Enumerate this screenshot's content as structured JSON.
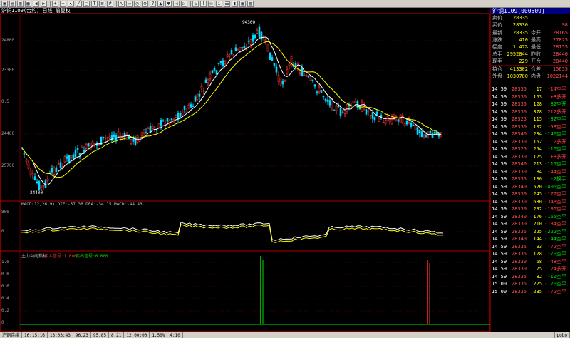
{
  "window": {
    "chart_title": "沪铜1109(合约) 日线 前复权",
    "instrument_title": "沪铜1109(000509)"
  },
  "toolbar": {
    "buttons": [
      "file",
      "open",
      "save",
      "print",
      "undo",
      "redo",
      "zoom-in",
      "zoom-out",
      "cursor",
      "line",
      "rect",
      "text",
      "fib",
      "grid",
      "indicator",
      "window",
      "period",
      "settings",
      "help",
      "up",
      "down",
      "left",
      "right",
      "refresh",
      "alert",
      "news",
      "info",
      "list",
      "chart",
      "table",
      "layout"
    ]
  },
  "price_axis": {
    "labels": [
      "24800",
      "23300",
      "0.5",
      "24400",
      "25700"
    ]
  },
  "panels": {
    "price": {
      "high_label": "94300",
      "low_label": "24400"
    },
    "macd": {
      "label": "MACD(12,26,9) DIF:-57.36 DEA:-34.15 MACD:-44.43",
      "axis": [
        "800",
        "0"
      ]
    },
    "signal": {
      "label1": "主力动向指标",
      "label2": "买入信号:1.000",
      "label3": "卖出信号:0.000",
      "axis": [
        "1.0",
        "0.8",
        "0.6",
        "0.4",
        "0.2",
        "0"
      ]
    }
  },
  "quote": {
    "rows": [
      {
        "l1": "卖价",
        "v1": "28335",
        "l2": "",
        "v2": ""
      },
      {
        "l1": "买价",
        "v1": "28330",
        "l2": "",
        "v2": "98"
      },
      {
        "l1": "最新",
        "v1": "28335",
        "l2": "今开",
        "v2": "28165"
      },
      {
        "l1": "涨跌",
        "v1": "410",
        "l2": "最高",
        "v2": "27825"
      },
      {
        "l1": "幅度",
        "v1": "1.47%",
        "l2": "最低",
        "v2": "28155"
      },
      {
        "l1": "总手",
        "v1": "2952844",
        "l2": "昨收",
        "v2": "28440"
      },
      {
        "l1": "现手",
        "v1": "229",
        "l2": "开仓",
        "v2": "28440"
      },
      {
        "l1": "持仓",
        "v1": "413302",
        "l2": "仓差",
        "v2": "15655"
      },
      {
        "l1": "外盘",
        "v1": "1030700",
        "l2": "内盘",
        "v2": "1022144"
      }
    ],
    "trades": [
      {
        "time": "14:59",
        "price": "28335",
        "vol": "17",
        "chg": "-14",
        "dir": "空平",
        "c": "red"
      },
      {
        "time": "14:59",
        "price": "28330",
        "vol": "163",
        "chg": "+8",
        "dir": "多开",
        "c": "red"
      },
      {
        "time": "14:59",
        "price": "28335",
        "vol": "128",
        "chg": "82",
        "dir": "空开",
        "c": "green"
      },
      {
        "time": "14:59",
        "price": "28330",
        "vol": "378",
        "chg": "212",
        "dir": "多开",
        "c": "red"
      },
      {
        "time": "14:59",
        "price": "28325",
        "vol": "115",
        "chg": "-82",
        "dir": "空平",
        "c": "green"
      },
      {
        "time": "14:59",
        "price": "28330",
        "vol": "102",
        "chg": "-58",
        "dir": "空平",
        "c": "red"
      },
      {
        "time": "14:59",
        "price": "28340",
        "vol": "234",
        "chg": "-140",
        "dir": "空平",
        "c": "green"
      },
      {
        "time": "14:59",
        "price": "28330",
        "vol": "162",
        "chg": "2",
        "dir": "多开",
        "c": "red"
      },
      {
        "time": "14:59",
        "price": "28325",
        "vol": "254",
        "chg": "-16",
        "dir": "空平",
        "c": "green"
      },
      {
        "time": "14:59",
        "price": "28330",
        "vol": "125",
        "chg": "+8",
        "dir": "多开",
        "c": "red"
      },
      {
        "time": "14:59",
        "price": "28340",
        "vol": "213",
        "chg": "-115",
        "dir": "空平",
        "c": "green"
      },
      {
        "time": "14:59",
        "price": "28330",
        "vol": "84",
        "chg": "-44",
        "dir": "空平",
        "c": "red"
      },
      {
        "time": "14:59",
        "price": "28335",
        "vol": "130",
        "chg": "-2",
        "dir": "换手",
        "c": "green"
      },
      {
        "time": "14:59",
        "price": "28340",
        "vol": "520",
        "chg": "-406",
        "dir": "空平",
        "c": "green"
      },
      {
        "time": "14:59",
        "price": "28330",
        "vol": "245",
        "chg": "-177",
        "dir": "空平",
        "c": "red"
      },
      {
        "time": "14:59",
        "price": "28330",
        "vol": "680",
        "chg": "-348",
        "dir": "空平",
        "c": "red"
      },
      {
        "time": "14:59",
        "price": "28330",
        "vol": "232",
        "chg": "-186",
        "dir": "空平",
        "c": "red"
      },
      {
        "time": "14:59",
        "price": "28340",
        "vol": "176",
        "chg": "-165",
        "dir": "空平",
        "c": "green"
      },
      {
        "time": "14:59",
        "price": "28330",
        "vol": "210",
        "chg": "-134",
        "dir": "空平",
        "c": "red"
      },
      {
        "time": "14:59",
        "price": "28335",
        "vol": "225",
        "chg": "-222",
        "dir": "空平",
        "c": "green"
      },
      {
        "time": "14:59",
        "price": "28340",
        "vol": "144",
        "chg": "-144",
        "dir": "空平",
        "c": "green"
      },
      {
        "time": "14:59",
        "price": "28335",
        "vol": "93",
        "chg": "-72",
        "dir": "空平",
        "c": "red"
      },
      {
        "time": "14:59",
        "price": "28335",
        "vol": "128",
        "chg": "-70",
        "dir": "空平",
        "c": "green"
      },
      {
        "time": "14:59",
        "price": "28330",
        "vol": "68",
        "chg": "-48",
        "dir": "空平",
        "c": "red"
      },
      {
        "time": "14:59",
        "price": "28330",
        "vol": "75",
        "chg": "24",
        "dir": "多开",
        "c": "red"
      },
      {
        "time": "14:59",
        "price": "28335",
        "vol": "82",
        "chg": "-10",
        "dir": "空平",
        "c": "green"
      },
      {
        "time": "15:00",
        "price": "28335",
        "vol": "225",
        "chg": "-170",
        "dir": "空平",
        "c": "green"
      },
      {
        "time": "15:00",
        "price": "28335",
        "vol": "235",
        "chg": "-72",
        "dir": "空平",
        "c": "red"
      }
    ]
  },
  "status": {
    "cells": [
      "沪铜连续",
      "16:15:16",
      "13:03:43",
      "96.23",
      "95.85",
      "8.21",
      "12:00:00",
      "1.50%",
      "4:10",
      "pobo"
    ]
  }
}
